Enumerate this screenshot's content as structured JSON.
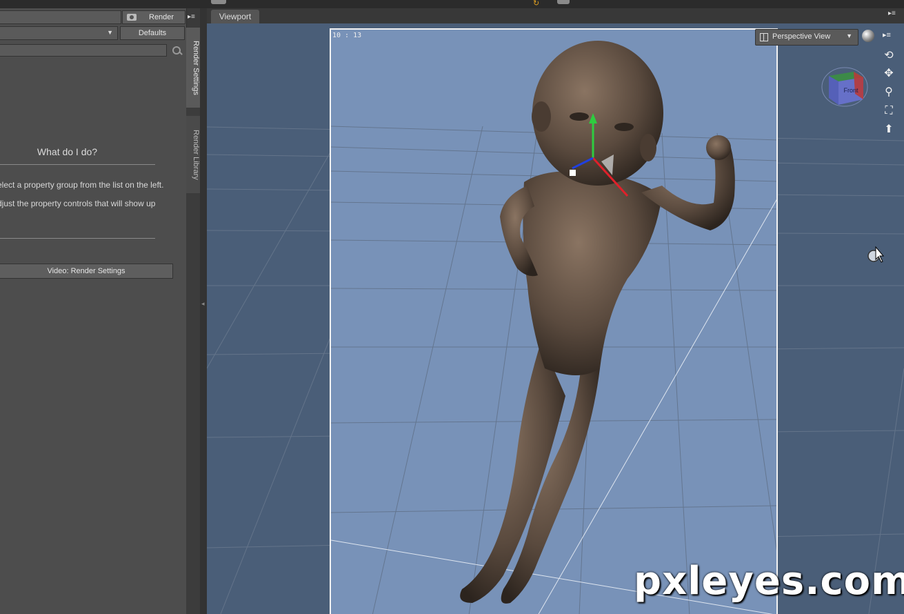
{
  "toolbar": {
    "render_label": "Render",
    "defaults_label": "Defaults"
  },
  "render_settings": {
    "help_title": "What do I do?",
    "help_line1": "Select a property group from the list on the left.",
    "help_line2": "Adjust the property controls that will show up",
    "video_button_label": "Video: Render Settings"
  },
  "side_tabs": {
    "render_settings": "Render Settings",
    "render_library": "Render Library"
  },
  "viewport": {
    "tab_label": "Viewport",
    "fps": "10 : 13",
    "view_label": "Perspective View",
    "cube_face": "Front",
    "background_color": "#4a5e78",
    "frame_color": "#7892b8"
  },
  "icons": {
    "orbit": "orbit-icon",
    "pan": "pan-icon",
    "zoom": "zoom-icon",
    "frame": "frame-icon",
    "home": "home-icon"
  },
  "watermark": "pxleyes.com"
}
